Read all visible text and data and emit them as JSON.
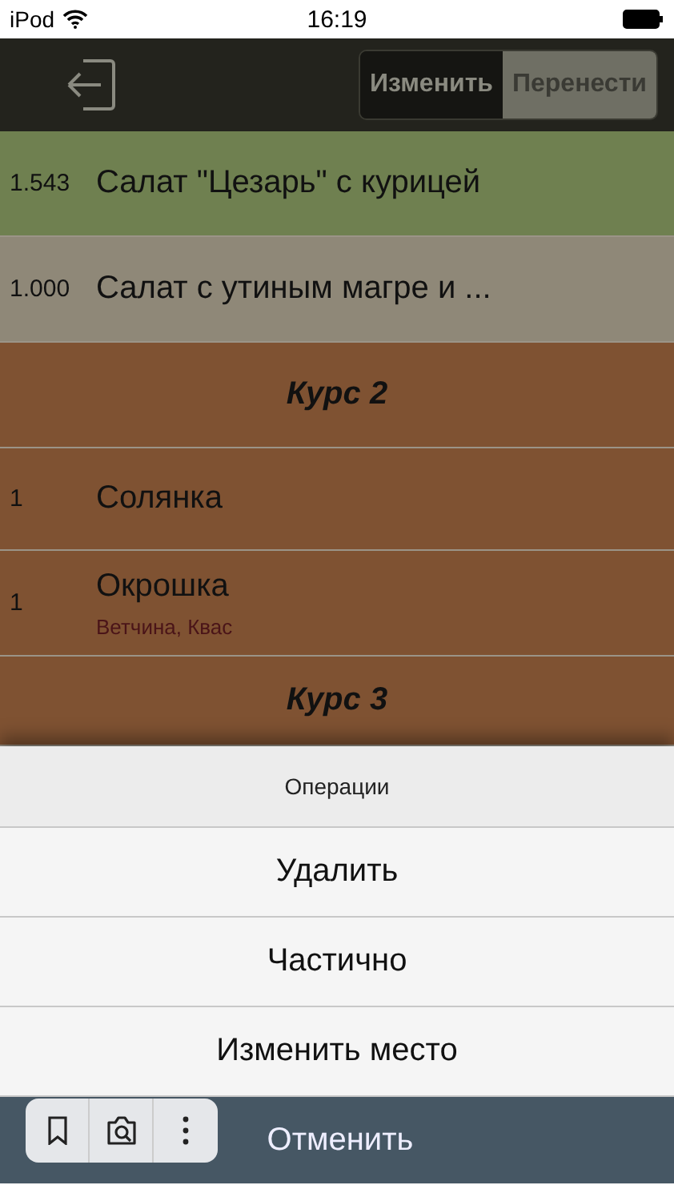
{
  "status_bar": {
    "device": "iPod",
    "time": "16:19"
  },
  "nav": {
    "segments": [
      {
        "label": "Изменить",
        "selected": true
      },
      {
        "label": "Перенести",
        "selected": false
      }
    ]
  },
  "rows": [
    {
      "kind": "item",
      "qty": "1.543",
      "name": "Салат \"Цезарь\" с курицей",
      "color": "#6f8050"
    },
    {
      "kind": "item",
      "qty": "1.000",
      "name": "Салат с утиным магре и ...",
      "color": "#8f8878"
    },
    {
      "kind": "header",
      "name": "Курс 2",
      "color": "#7f5232"
    },
    {
      "kind": "item",
      "qty": "1",
      "name": "Солянка",
      "color": "#7f5232"
    },
    {
      "kind": "item",
      "qty": "1",
      "name": "Окрошка",
      "modifiers": "Ветчина, Квас",
      "color": "#7f5232"
    },
    {
      "kind": "header",
      "name": "Курс 3",
      "color": "#7f5232"
    }
  ],
  "action_sheet": {
    "title": "Операции",
    "actions": [
      "Удалить",
      "Частично",
      "Изменить место"
    ],
    "cancel": "Отменить"
  }
}
